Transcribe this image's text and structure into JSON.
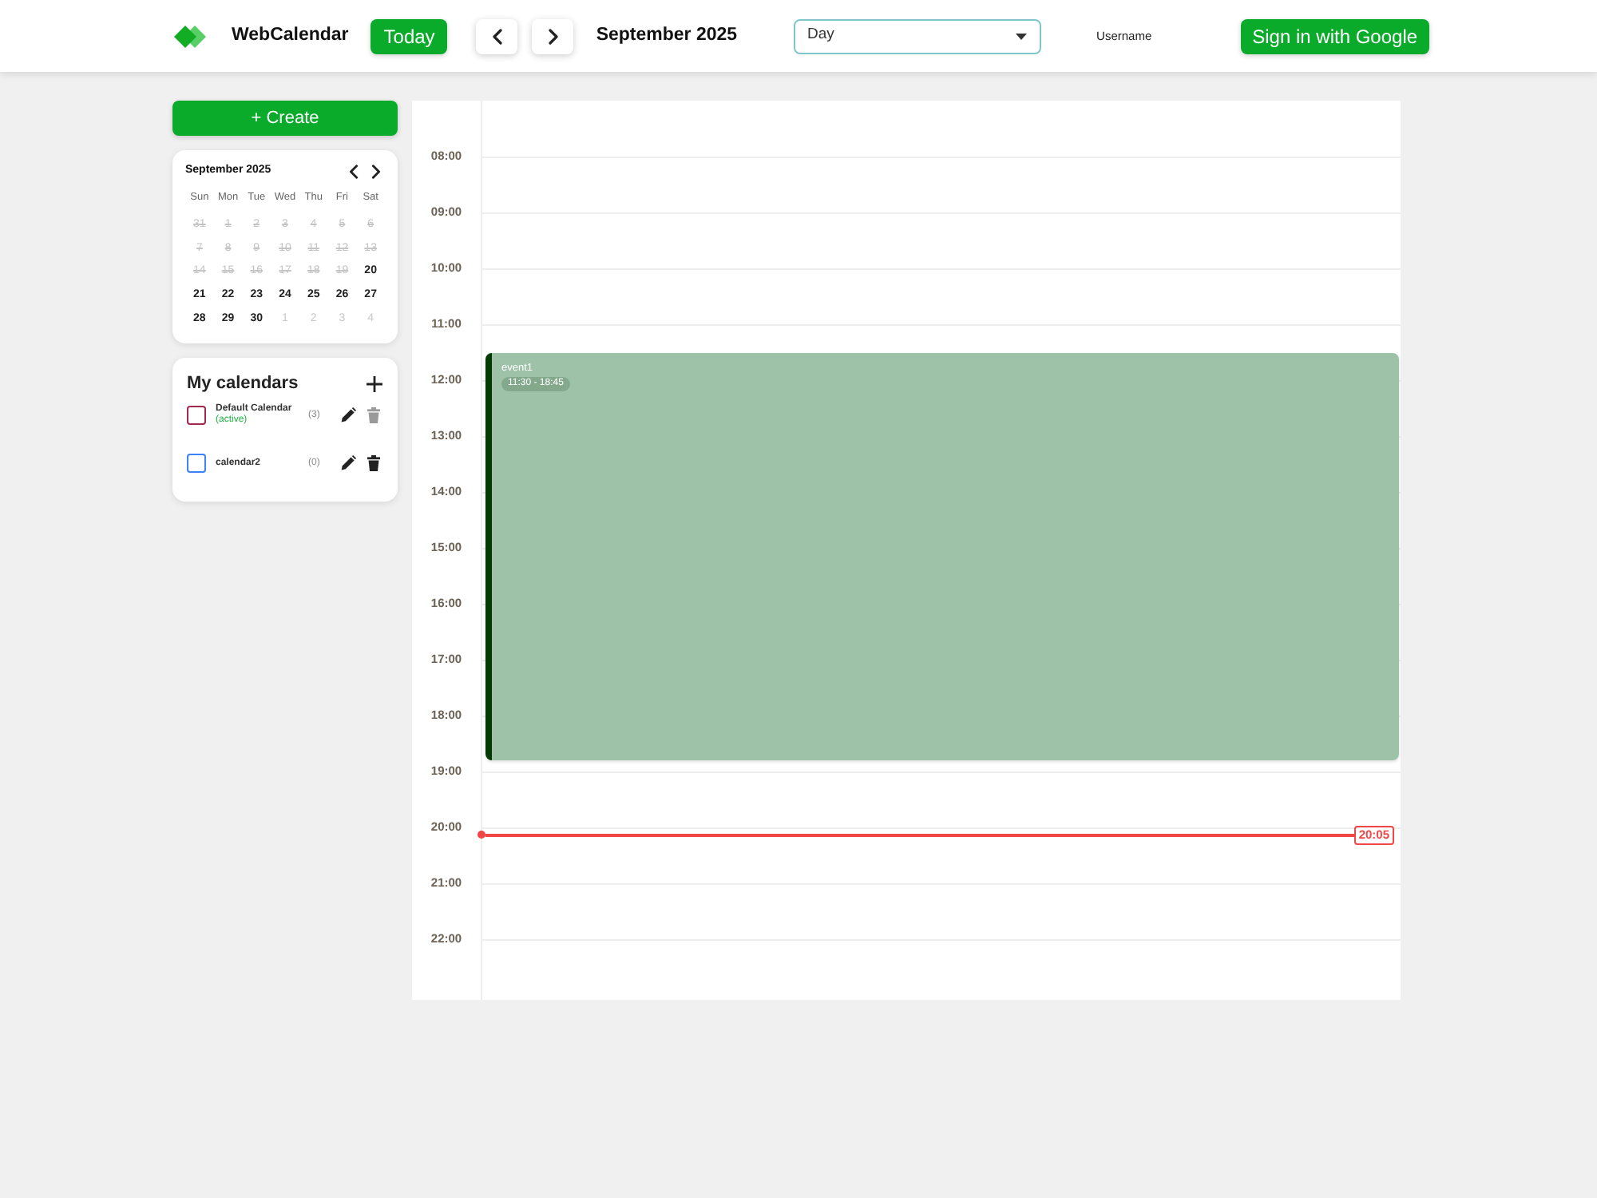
{
  "header": {
    "app_name": "WebCalendar",
    "today_button": "Today",
    "period_title": "September 2025",
    "view_select": {
      "value": "Day"
    },
    "username": "Username",
    "sign_in_button": "Sign in with Google"
  },
  "sidebar": {
    "create_button": "+ Create",
    "mini_calendar": {
      "title": "September 2025",
      "weekdays": [
        "Sun",
        "Mon",
        "Tue",
        "Wed",
        "Thu",
        "Fri",
        "Sat"
      ],
      "days": [
        {
          "label": "31",
          "kind": "past"
        },
        {
          "label": "1",
          "kind": "past"
        },
        {
          "label": "2",
          "kind": "past"
        },
        {
          "label": "3",
          "kind": "past"
        },
        {
          "label": "4",
          "kind": "past"
        },
        {
          "label": "5",
          "kind": "past"
        },
        {
          "label": "6",
          "kind": "past"
        },
        {
          "label": "7",
          "kind": "past"
        },
        {
          "label": "8",
          "kind": "past"
        },
        {
          "label": "9",
          "kind": "past"
        },
        {
          "label": "10",
          "kind": "past"
        },
        {
          "label": "11",
          "kind": "past"
        },
        {
          "label": "12",
          "kind": "past"
        },
        {
          "label": "13",
          "kind": "past"
        },
        {
          "label": "14",
          "kind": "past"
        },
        {
          "label": "15",
          "kind": "past"
        },
        {
          "label": "16",
          "kind": "past"
        },
        {
          "label": "17",
          "kind": "past"
        },
        {
          "label": "18",
          "kind": "past"
        },
        {
          "label": "19",
          "kind": "past"
        },
        {
          "label": "20",
          "kind": "day"
        },
        {
          "label": "21",
          "kind": "day"
        },
        {
          "label": "22",
          "kind": "day"
        },
        {
          "label": "23",
          "kind": "day"
        },
        {
          "label": "24",
          "kind": "day"
        },
        {
          "label": "25",
          "kind": "day"
        },
        {
          "label": "26",
          "kind": "day"
        },
        {
          "label": "27",
          "kind": "day"
        },
        {
          "label": "28",
          "kind": "day"
        },
        {
          "label": "29",
          "kind": "day"
        },
        {
          "label": "30",
          "kind": "day"
        },
        {
          "label": "1",
          "kind": "next"
        },
        {
          "label": "2",
          "kind": "next"
        },
        {
          "label": "3",
          "kind": "next"
        },
        {
          "label": "4",
          "kind": "next"
        }
      ]
    },
    "calendars": {
      "title": "My calendars",
      "items": [
        {
          "name": "Default Calendar",
          "tag": "(active)",
          "count": "(3)",
          "color": "#a3294f",
          "checked": false,
          "delete_disabled": true
        },
        {
          "name": "calendar2",
          "count": "(0)",
          "color": "#3b82f6",
          "checked": false,
          "delete_disabled": false
        }
      ]
    }
  },
  "day_view": {
    "hours": [
      "08:00",
      "09:00",
      "10:00",
      "11:00",
      "12:00",
      "13:00",
      "14:00",
      "15:00",
      "16:00",
      "17:00",
      "18:00",
      "19:00",
      "20:00",
      "21:00",
      "22:00"
    ],
    "events": [
      {
        "title": "event1",
        "time": "11:30 - 18:45"
      }
    ],
    "now_marker": {
      "time": "20:05"
    }
  }
}
